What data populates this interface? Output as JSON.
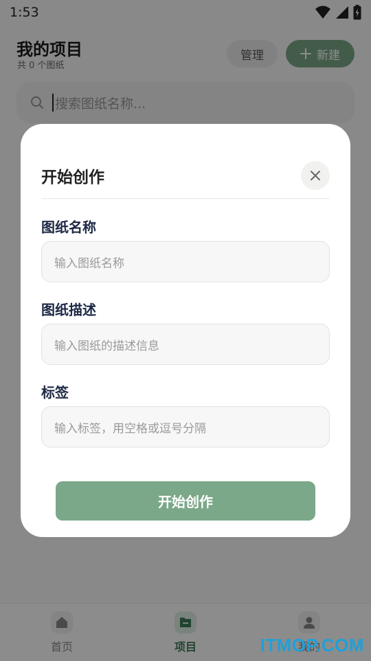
{
  "status_bar": {
    "time": "1:53"
  },
  "header": {
    "title": "我的项目",
    "subtitle": "共 0 个图纸",
    "manage_label": "管理",
    "new_label": "新建"
  },
  "search": {
    "placeholder": "搜索图纸名称..."
  },
  "dialog": {
    "title": "开始创作",
    "fields": [
      {
        "label": "图纸名称",
        "placeholder": "输入图纸名称"
      },
      {
        "label": "图纸描述",
        "placeholder": "输入图纸的描述信息"
      },
      {
        "label": "标签",
        "placeholder": "输入标签，用空格或逗号分隔"
      }
    ],
    "submit_label": "开始创作"
  },
  "bottom_nav": {
    "items": [
      {
        "label": "首页",
        "icon": "home-icon"
      },
      {
        "label": "项目",
        "icon": "folder-icon",
        "active": true
      },
      {
        "label": "我的",
        "icon": "user-icon"
      }
    ]
  },
  "watermark": "ITMOP.COM",
  "colors": {
    "accent": "#7ba888",
    "active_nav": "#3d7a56"
  }
}
